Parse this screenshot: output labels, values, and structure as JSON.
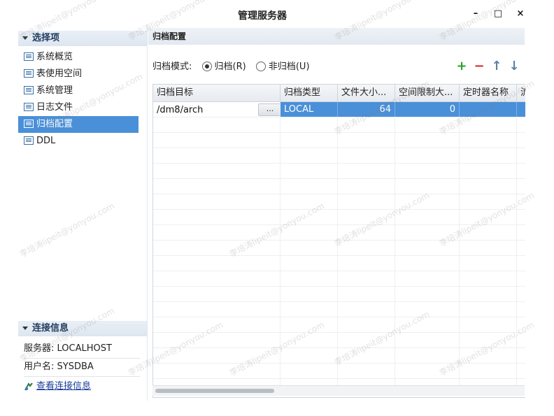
{
  "window": {
    "title": "管理服务器",
    "min_label": "–",
    "max_label": "□",
    "close_label": "×"
  },
  "sidebar": {
    "section_title": "选择项",
    "items": [
      {
        "label": "系统概览",
        "selected": false
      },
      {
        "label": "表使用空间",
        "selected": false
      },
      {
        "label": "系统管理",
        "selected": false
      },
      {
        "label": "日志文件",
        "selected": false
      },
      {
        "label": "归档配置",
        "selected": true
      },
      {
        "label": "DDL",
        "selected": false
      }
    ],
    "connection_title": "连接信息",
    "server_label": "服务器:",
    "server_value": "LOCALHOST",
    "user_label": "用户名:",
    "user_value": "SYSDBA",
    "view_link": "查看连接信息"
  },
  "main": {
    "header": "归档配置",
    "mode_label": "归档模式:",
    "mode_options": [
      {
        "label": "归档(R)",
        "selected": true
      },
      {
        "label": "非归档(U)",
        "selected": false
      }
    ],
    "toolbar": {
      "add": "+",
      "remove": "−",
      "up": "↑",
      "down": "↓",
      "add_color": "#22a32a",
      "remove_color": "#d32b2b",
      "arrow_color": "#5b7fa6"
    },
    "table": {
      "columns": [
        "归档目标",
        "归档类型",
        "文件大小...",
        "空间限制大...",
        "定时器名称",
        "流"
      ],
      "rows": [
        {
          "target": "/dm8/arch",
          "browse": "...",
          "type": "LOCAL",
          "file_size": "64",
          "space_limit": "0",
          "timer": "",
          "extra": ""
        }
      ]
    }
  },
  "watermark": "李培涛lipeit@yonyou.com"
}
